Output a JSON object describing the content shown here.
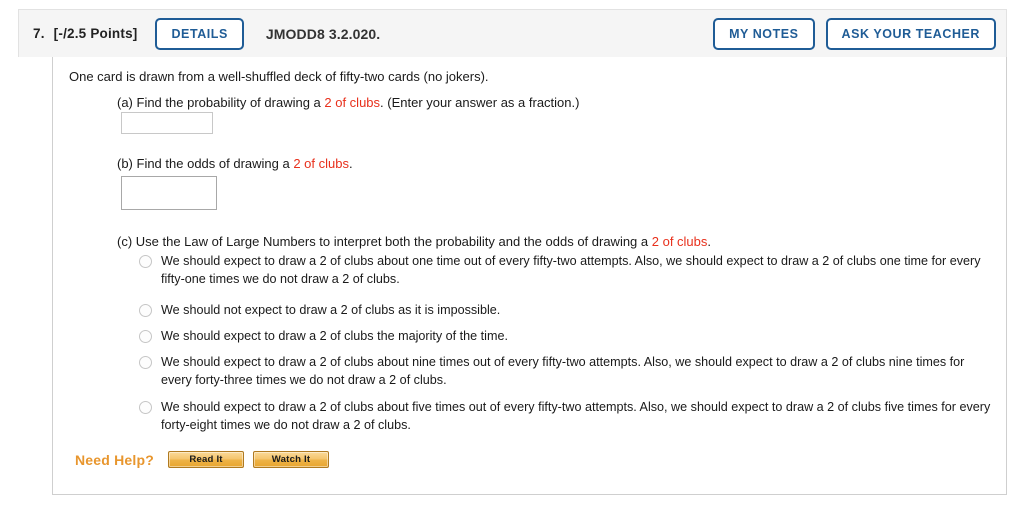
{
  "header": {
    "question_number": "7.",
    "points": "[-/2.5 Points]",
    "details_label": "DETAILS",
    "title": "JMODD8 3.2.020.",
    "my_notes_label": "MY NOTES",
    "ask_teacher_label": "ASK YOUR TEACHER"
  },
  "question": {
    "stem": "One card is drawn from a well-shuffled deck of fifty-two cards (no jokers).",
    "parts": {
      "a": {
        "prefix": "(a) Find the probability of drawing a ",
        "highlight": "2 of clubs",
        "suffix": ". (Enter your answer as a fraction.)",
        "input_value": "",
        "input_placeholder": ""
      },
      "b": {
        "prefix": "(b) Find the odds of drawing a ",
        "highlight": "2 of clubs",
        "suffix": ".",
        "input_value": "",
        "input_placeholder": ""
      },
      "c": {
        "prefix": "(c) Use the Law of Large Numbers to interpret both the probability and the odds of drawing a ",
        "highlight": "2 of clubs",
        "suffix": ".",
        "options": [
          "We should expect to draw a 2 of clubs about one time out of every fifty-two attempts. Also, we should expect to draw a 2 of clubs one time for every fifty-one times we do not draw a 2 of clubs.",
          "We should not expect to draw a 2 of clubs as it is impossible.",
          "We should expect to draw a 2 of clubs the majority of the time.",
          "We should expect to draw a 2 of clubs about nine times out of every fifty-two attempts. Also, we should expect to draw a 2 of clubs nine times for every forty-three times we do not draw a 2 of clubs.",
          "We should expect to draw a 2 of clubs about five times out of every fifty-two attempts. Also, we should expect to draw a 2 of clubs five times for every forty-eight times we do not draw a 2 of clubs."
        ]
      }
    }
  },
  "help": {
    "label": "Need Help?",
    "read_it_label": "Read It",
    "watch_it_label": "Watch It"
  },
  "colors": {
    "accent_blue": "#1f5c96",
    "highlight_red": "#e8301c",
    "help_orange": "#e8962e",
    "header_bg": "#f5f5f5"
  }
}
